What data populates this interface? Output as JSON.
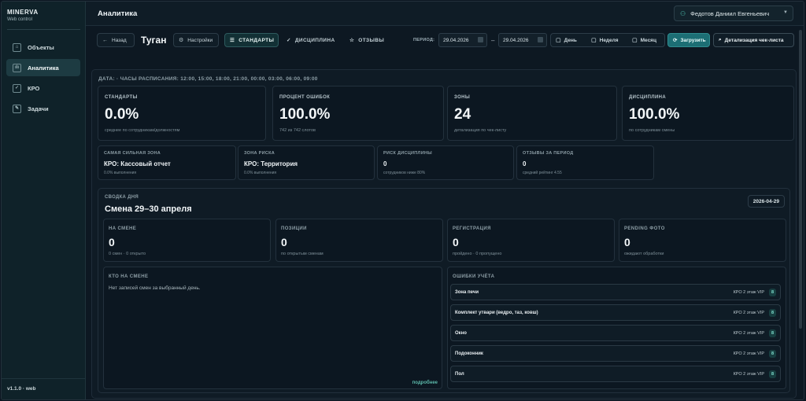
{
  "sidebar": {
    "brand_name": "MINERVA",
    "brand_sub": "Web control",
    "items": [
      {
        "label": "Объекты",
        "icon": "home-icon"
      },
      {
        "label": "Аналитика",
        "icon": "chart-icon"
      },
      {
        "label": "КРО",
        "icon": "checklist-icon"
      },
      {
        "label": "Задачи",
        "icon": "task-icon"
      }
    ],
    "version": "v1.1.0 · web"
  },
  "header": {
    "title": "Аналитика",
    "user": "Федотов Даниил Евгеньевич"
  },
  "toolbar": {
    "back_label": "Назад",
    "object_title": "Туган",
    "settings_label": "Настройки",
    "tabs": [
      {
        "label": "СТАНДАРТЫ",
        "active": true
      },
      {
        "label": "ДИСЦИПЛИНА",
        "active": false
      },
      {
        "label": "ОТЗЫВЫ",
        "active": false
      }
    ],
    "period_label": "ПЕРИОД:",
    "date_from": "29.04.2026",
    "date_to": "29.04.2026",
    "range_day": "День",
    "range_week": "Неделя",
    "range_month": "Месяц",
    "load_label": "Загрузить",
    "detail_label": "Детализация чек-листа"
  },
  "main": {
    "schedule_line": "ДАТА: · ЧАСЫ РАСПИСАНИЯ: 12:00, 15:00, 18:00, 21:00, 00:00, 03:00, 06:00, 09:00",
    "kpis": [
      {
        "label": "СТАНДАРТЫ",
        "value": "0.0%",
        "sub": "среднее по сотрудникам/должностям"
      },
      {
        "label": "ПРОЦЕНТ ОШИБОК",
        "value": "100.0%",
        "sub": "742 из 742 слотов"
      },
      {
        "label": "ЗОНЫ",
        "value": "24",
        "sub": "детализация по чек-листу"
      },
      {
        "label": "ДИСЦИПЛИНА",
        "value": "100.0%",
        "sub": "по сотрудникам смены"
      }
    ],
    "minis": [
      {
        "label": "САМАЯ СИЛЬНАЯ ЗОНА",
        "value": "КРО: Кассовый отчет",
        "sub": "0.0% выполнения"
      },
      {
        "label": "ЗОНА РИСКА",
        "value": "КРО: Территория",
        "sub": "0.0% выполнения"
      },
      {
        "label": "РИСК ДИСЦИПЛИНЫ",
        "value": "0",
        "sub": "сотрудников ниже 80%"
      },
      {
        "label": "ОТЗЫВЫ ЗА ПЕРИОД",
        "value": "0",
        "sub": "средний рейтинг 4.55"
      }
    ]
  },
  "day": {
    "label": "СВОДКА ДНЯ",
    "title": "Смена 29–30 апреля",
    "date": "2026-04-29",
    "stats": [
      {
        "label": "НА СМЕНЕ",
        "value": "0",
        "sub": "0 смен · 0 открыто"
      },
      {
        "label": "ПОЗИЦИИ",
        "value": "0",
        "sub": "по открытым сменам"
      },
      {
        "label": "РЕГИСТРАЦИЯ",
        "value": "0",
        "sub": "пройдено · 0 пропущено"
      },
      {
        "label": "PENDING ФОТО",
        "value": "0",
        "sub": "ожидают обработки"
      }
    ],
    "who_label": "КТО НА СМЕНЕ",
    "who_empty": "Нет записей смен за выбранный день.",
    "who_more": "подробнее",
    "errors_label": "ОШИБКИ УЧЁТА",
    "errors": [
      {
        "name": "Зона печи",
        "location": "КРО 2 этаж VIP",
        "count": "8"
      },
      {
        "name": "Комплект утвари (ведро, таз, ковш)",
        "location": "КРО 2 этаж VIP",
        "count": "8"
      },
      {
        "name": "Окно",
        "location": "КРО 2 этаж VIP",
        "count": "8"
      },
      {
        "name": "Подоконник",
        "location": "КРО 2 этаж VIP",
        "count": "8"
      },
      {
        "name": "Пол",
        "location": "КРО 2 этаж VIP",
        "count": "8"
      }
    ]
  }
}
